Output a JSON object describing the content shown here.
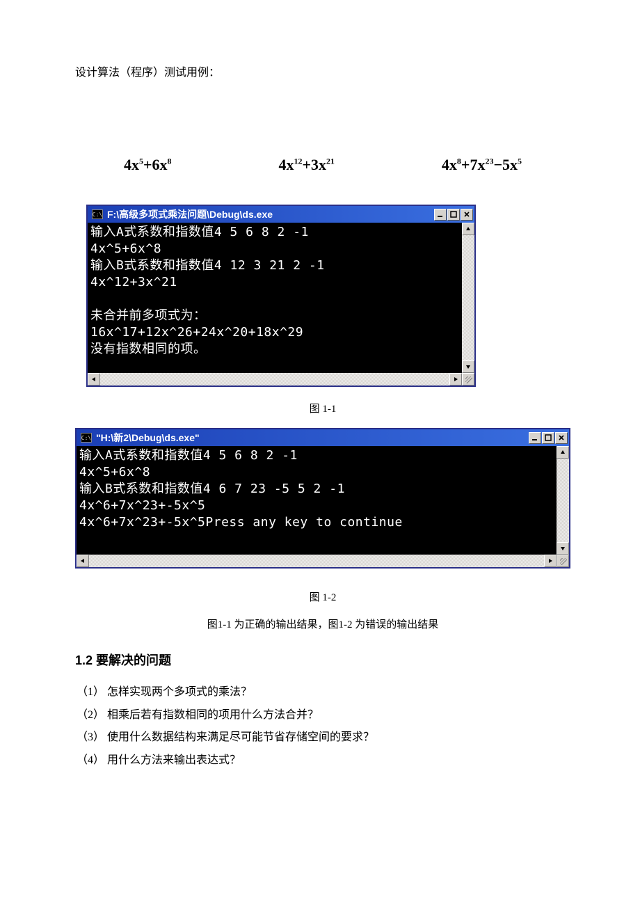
{
  "intro": "设计算法（程序）测试用例：",
  "formulas": {
    "f1": {
      "a": "4x",
      "e1": "5",
      "mid": "+6x",
      "e2": "8"
    },
    "f2": {
      "a": "4x",
      "e1": "12",
      "mid": "+3x",
      "e2": "21"
    },
    "f3": {
      "a": "4x",
      "e1": "8",
      "mid1": "+7x",
      "e2": "23",
      "mid2": "−5x",
      "e3": "5"
    }
  },
  "win1": {
    "title": "F:\\高级多项式乘法问题\\Debug\\ds.exe",
    "lines": [
      "输入A式系数和指数值4 5 6 8 2 -1",
      "4x^5+6x^8",
      "输入B式系数和指数值4 12 3 21 2 -1",
      "4x^12+3x^21",
      "",
      "未合并前多项式为：",
      "16x^17+12x^26+24x^20+18x^29",
      "没有指数相同的项。"
    ]
  },
  "caption1": "图 1-1",
  "win2": {
    "title": "\"H:\\新2\\Debug\\ds.exe\"",
    "lines": [
      "输入A式系数和指数值4 5 6 8 2 -1",
      "4x^5+6x^8",
      "输入B式系数和指数值4 6 7 23 -5 5 2 -1",
      "4x^6+7x^23+-5x^5",
      "4x^6+7x^23+-5x^5Press any key to continue"
    ]
  },
  "caption2": "图 1-2",
  "captionNote": "图1-1 为正确的输出结果，图1-2 为错误的输出结果",
  "sectionHeading": "1.2 要解决的问题",
  "questions": [
    "（1） 怎样实现两个多项式的乘法？",
    "（2） 相乘后若有指数相同的项用什么方法合并？",
    "（3） 使用什么数据结构来满足尽可能节省存储空间的要求？",
    "（4） 用什么方法来输出表达式？"
  ]
}
